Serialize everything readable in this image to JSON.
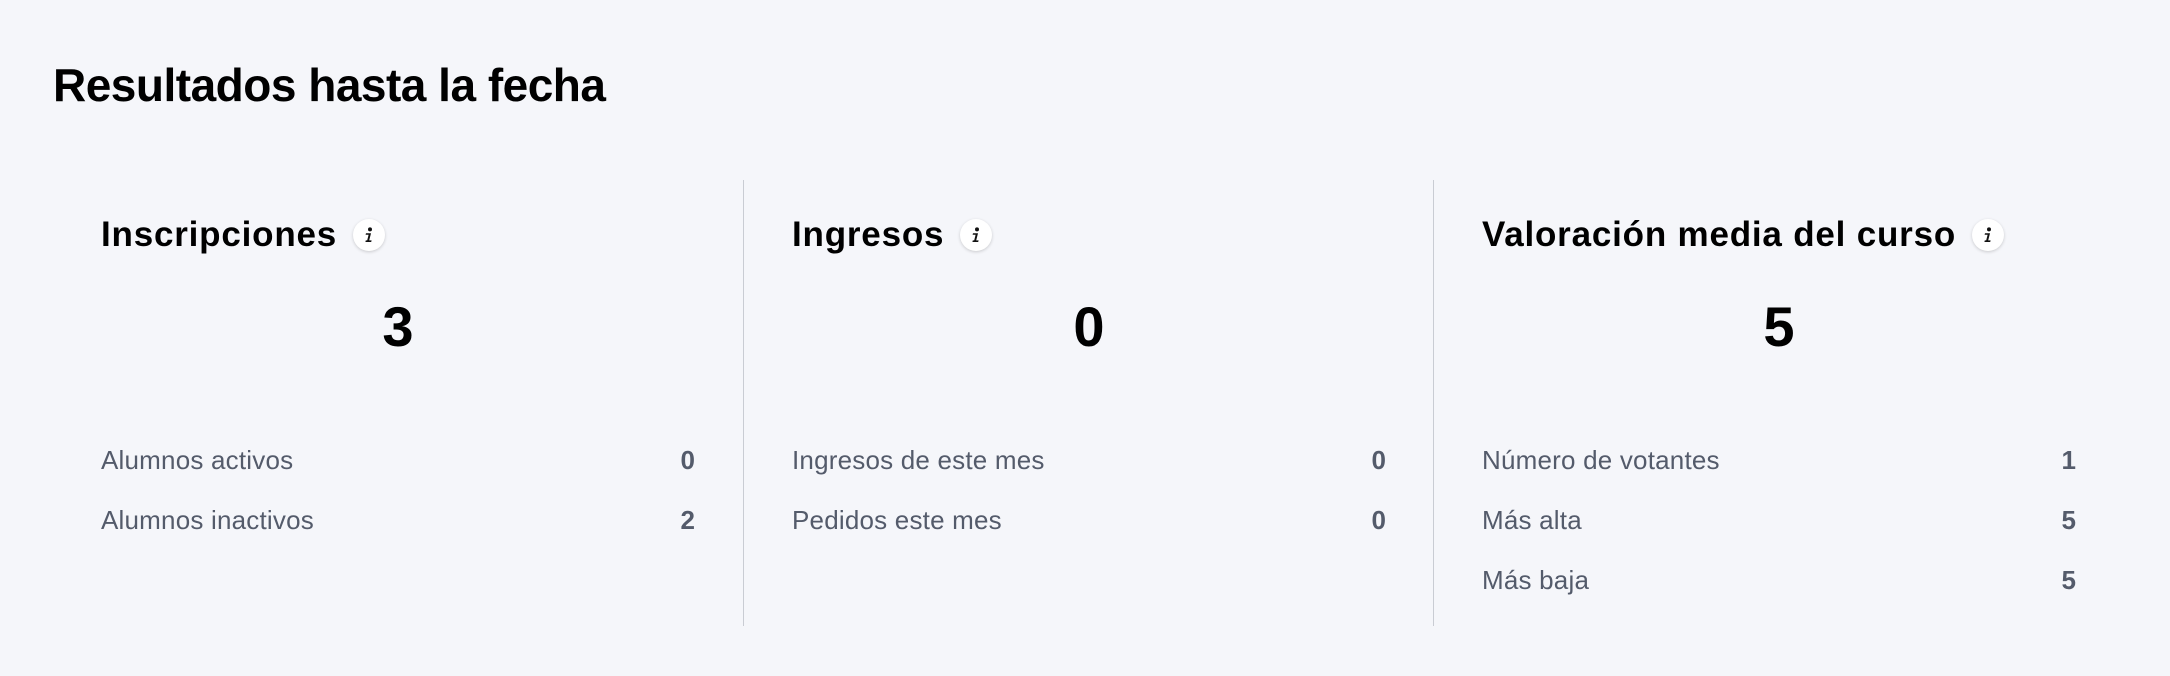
{
  "page": {
    "title": "Resultados hasta la fecha"
  },
  "panels": [
    {
      "title": "Inscripciones",
      "value": "3",
      "stats": [
        {
          "label": "Alumnos activos",
          "value": "0"
        },
        {
          "label": "Alumnos inactivos",
          "value": "2"
        }
      ]
    },
    {
      "title": "Ingresos",
      "value": "0",
      "stats": [
        {
          "label": "Ingresos de este mes",
          "value": "0"
        },
        {
          "label": "Pedidos este mes",
          "value": "0"
        }
      ]
    },
    {
      "title": "Valoración media del curso",
      "value": "5",
      "stats": [
        {
          "label": "Número de votantes",
          "value": "1"
        },
        {
          "label": "Más alta",
          "value": "5"
        },
        {
          "label": "Más baja",
          "value": "5"
        }
      ]
    }
  ],
  "icons": {
    "info": "info-icon"
  }
}
